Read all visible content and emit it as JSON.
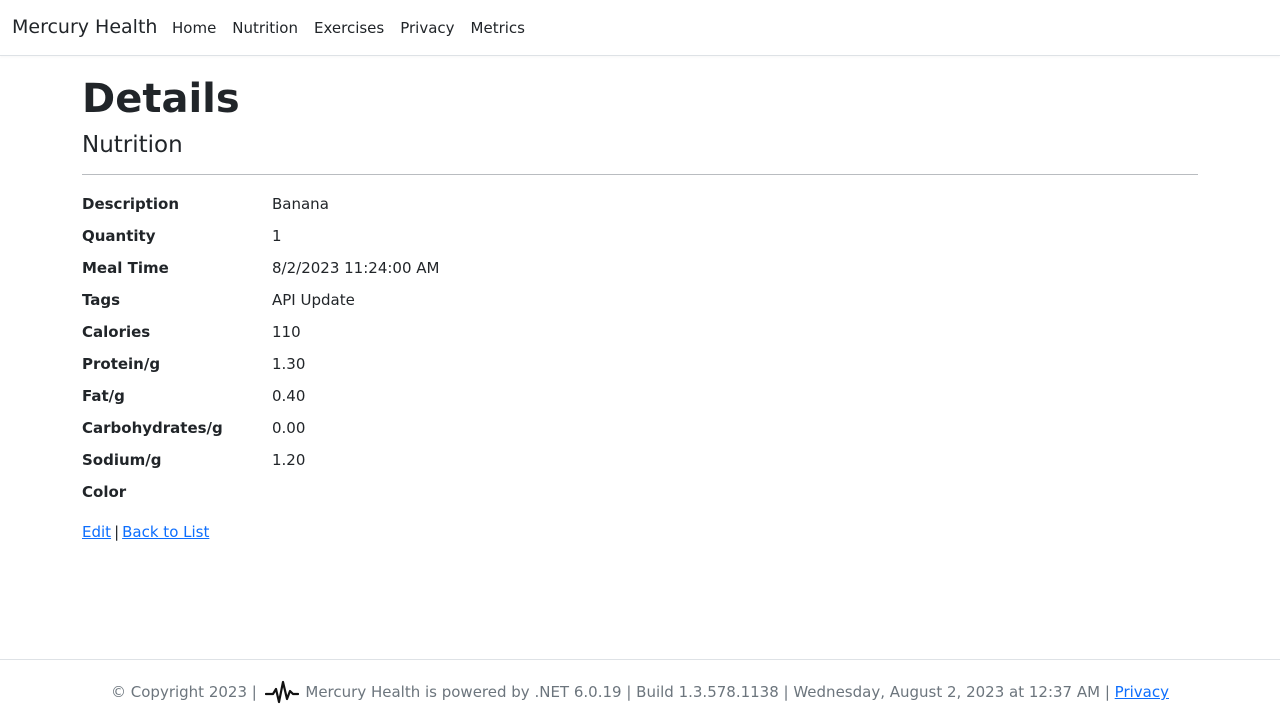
{
  "navbar": {
    "brand": "Mercury Health",
    "links": [
      "Home",
      "Nutrition",
      "Exercises",
      "Privacy",
      "Metrics"
    ]
  },
  "page": {
    "title": "Details",
    "subtitle": "Nutrition"
  },
  "details": [
    {
      "label": "Description",
      "value": "Banana"
    },
    {
      "label": "Quantity",
      "value": "1"
    },
    {
      "label": "Meal Time",
      "value": "8/2/2023 11:24:00 AM"
    },
    {
      "label": "Tags",
      "value": "API Update"
    },
    {
      "label": "Calories",
      "value": "110"
    },
    {
      "label": "Protein/g",
      "value": "1.30"
    },
    {
      "label": "Fat/g",
      "value": "0.40"
    },
    {
      "label": "Carbohydrates/g",
      "value": "0.00"
    },
    {
      "label": "Sodium/g",
      "value": "1.20"
    },
    {
      "label": "Color",
      "value": ""
    }
  ],
  "actions": {
    "edit_label": "Edit",
    "separator": "|",
    "back_label": "Back to List"
  },
  "footer": {
    "copyright": "© Copyright 2023 |",
    "info": "Mercury Health is powered by .NET 6.0.19 | Build 1.3.578.1138 | Wednesday, August 2, 2023 at 12:37 AM |",
    "privacy_label": "Privacy",
    "logo_icon": "heartbeat-pulse-icon"
  },
  "colors": {
    "link": "#0d6efd",
    "text": "#212529",
    "muted": "#6c757d"
  }
}
